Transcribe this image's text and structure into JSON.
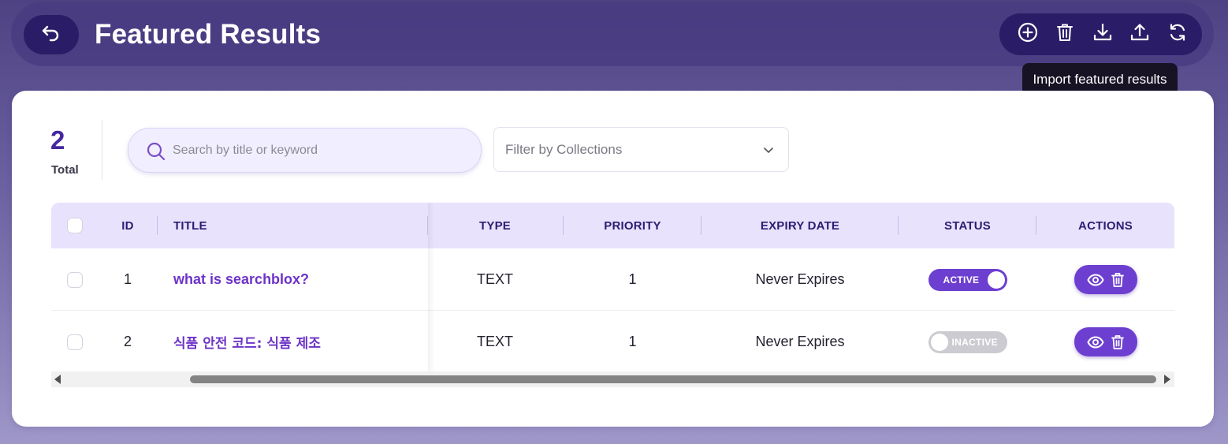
{
  "header": {
    "title": "Featured Results",
    "tooltip": "Import featured results",
    "tools": [
      {
        "name": "add",
        "icon": "plus-circle-icon"
      },
      {
        "name": "delete",
        "icon": "trash-icon"
      },
      {
        "name": "import",
        "icon": "download-icon"
      },
      {
        "name": "export",
        "icon": "upload-icon"
      },
      {
        "name": "refresh",
        "icon": "refresh-icon"
      }
    ],
    "back_icon": "undo-arrow-icon"
  },
  "summary": {
    "total_count": "2",
    "total_label": "Total"
  },
  "search": {
    "placeholder": "Search by title or keyword",
    "value": ""
  },
  "filter": {
    "placeholder": "Filter by Collections"
  },
  "table": {
    "columns": {
      "id": "ID",
      "title": "TITLE",
      "type": "TYPE",
      "priority": "PRIORITY",
      "expiry": "EXPIRY DATE",
      "status": "STATUS",
      "actions": "ACTIONS"
    },
    "rows": [
      {
        "id": "1",
        "title": "what is searchblox?",
        "type": "TEXT",
        "priority": "1",
        "expiry": "Never Expires",
        "status": "ACTIVE",
        "active": true
      },
      {
        "id": "2",
        "title": "식품 안전 코드: 식품 제조",
        "type": "TEXT",
        "priority": "1",
        "expiry": "Never Expires",
        "status": "INACTIVE",
        "active": false
      }
    ]
  },
  "colors": {
    "accent": "#6d3fd0",
    "header_dark": "#2a1c66",
    "title_link": "#6d33c7",
    "table_header_bg": "#e8e2fc"
  }
}
